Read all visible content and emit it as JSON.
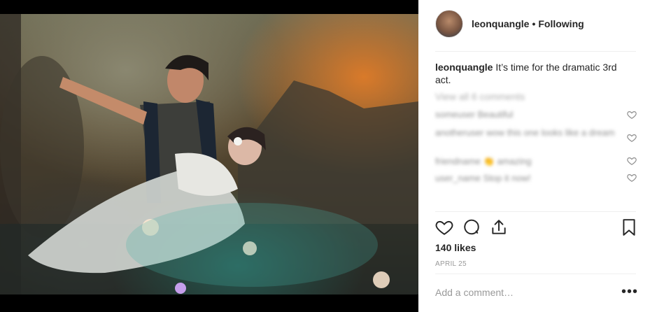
{
  "post": {
    "image_alt": "Stage performance photo",
    "colors": {
      "accent": "#262626",
      "muted": "#8e8e8e",
      "divider": "#efefef"
    }
  },
  "header": {
    "username": "leonquangle",
    "separator": "•",
    "follow_status": "Following"
  },
  "caption": {
    "username": "leonquangle",
    "text": "It’s time for the dramatic 3rd act."
  },
  "comments": {
    "view_all_label": "View all 6 comments",
    "items": [
      {
        "text": "someuser Beautiful"
      },
      {
        "text": "anotheruser wow this one looks like a dream"
      },
      {
        "text": "friendname 👏 amazing"
      },
      {
        "text": "user_name Stop it now!"
      }
    ]
  },
  "actions": {
    "like_icon": "heart-outline",
    "comment_icon": "speech-bubble",
    "share_icon": "share-arrow",
    "save_icon": "bookmark-outline"
  },
  "likes": {
    "label": "140 likes"
  },
  "date": {
    "label": "APRIL 25"
  },
  "add_comment": {
    "placeholder": "Add a comment…",
    "more_label": "•••"
  }
}
